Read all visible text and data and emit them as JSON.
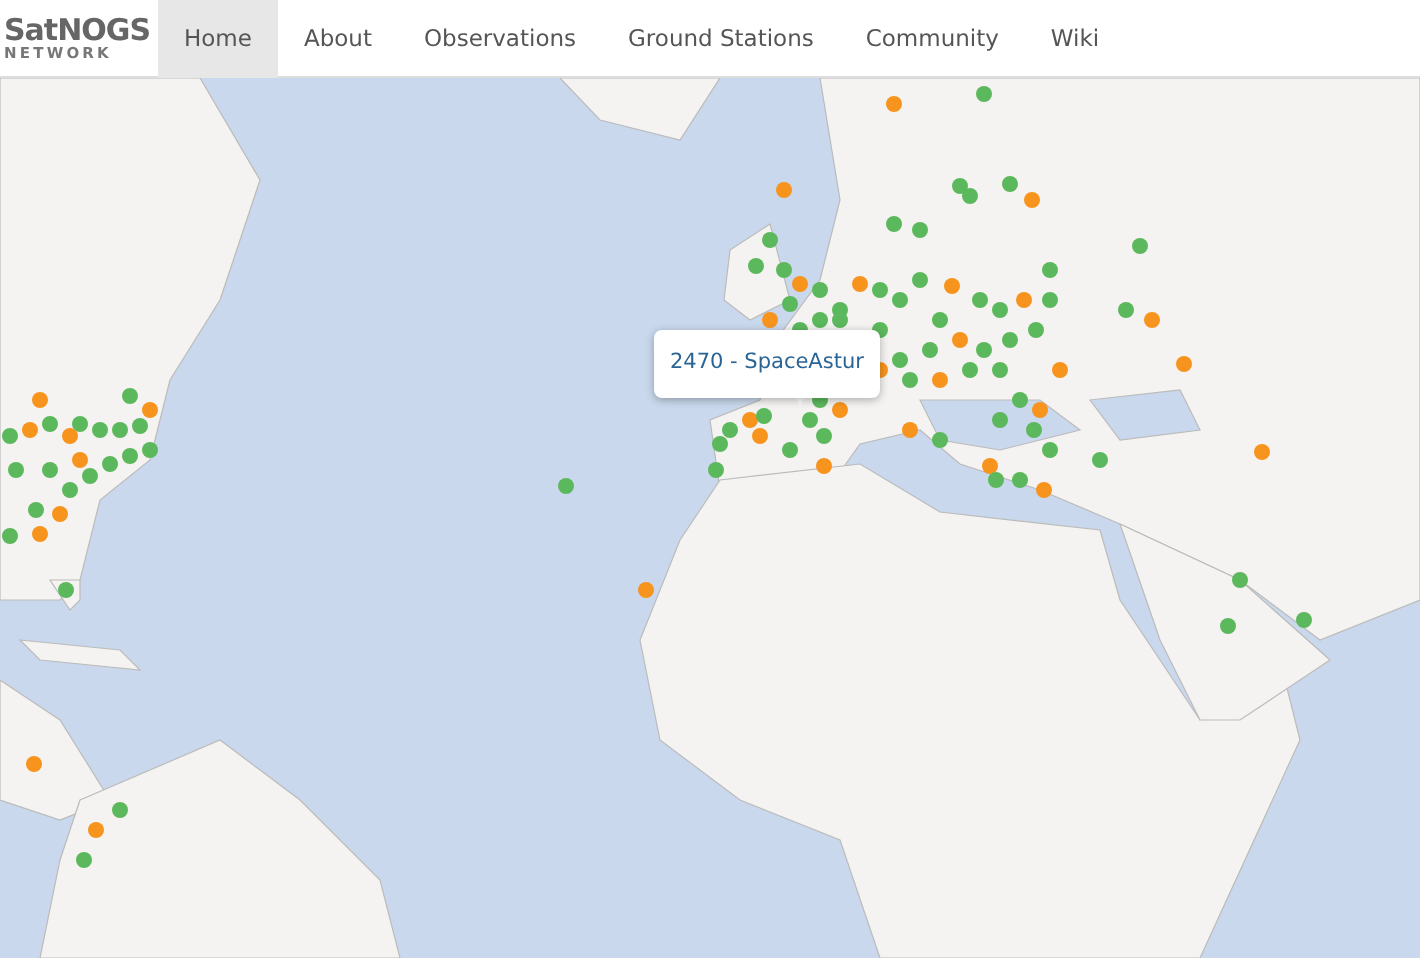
{
  "brand": {
    "title": "SatNOGS",
    "subtitle": "NETWORK"
  },
  "nav": [
    {
      "label": "Home",
      "selected": true
    },
    {
      "label": "About",
      "selected": false
    },
    {
      "label": "Observations",
      "selected": false
    },
    {
      "label": "Ground Stations",
      "selected": false
    },
    {
      "label": "Community",
      "selected": false
    },
    {
      "label": "Wiki",
      "selected": false
    }
  ],
  "map": {
    "tooltip": "2470 - SpaceAstur"
  }
}
